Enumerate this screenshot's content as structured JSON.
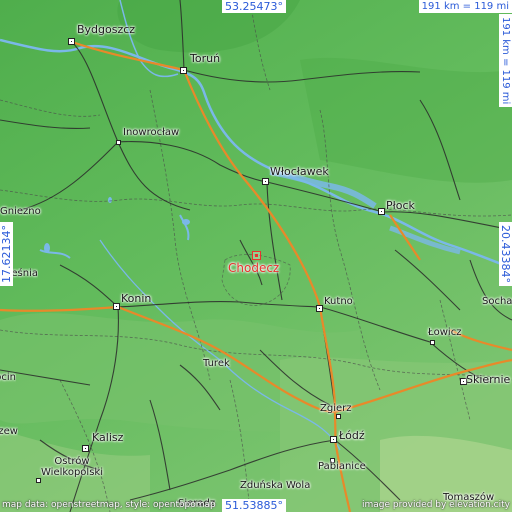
{
  "map": {
    "target": "Chodecz",
    "coords": {
      "top": "53.25473°",
      "bottom": "51.53885°",
      "left": "17.62134°",
      "right": "20.43384°"
    },
    "scale": "191 km = 119 mi",
    "credit_left": "map data: openstreetmap, style: opentopomap",
    "credit_right": "image provided by elevation.city",
    "colors": {
      "land": "#5fb85a",
      "water": "#7ab8e8",
      "road_major": "#e8892a",
      "road_minor": "#2a2a2a",
      "target": "#e8322f",
      "coord_text": "#2a5ad8"
    },
    "cities": [
      {
        "name": "Bydgoszcz"
      },
      {
        "name": "Toruń"
      },
      {
        "name": "Inowrocław"
      },
      {
        "name": "Włocławek"
      },
      {
        "name": "Płock"
      },
      {
        "name": "Gniezno"
      },
      {
        "name": "Konin"
      },
      {
        "name": "Kutno"
      },
      {
        "name": "Łowicz"
      },
      {
        "name": "Sochac"
      },
      {
        "name": "Skiernie"
      },
      {
        "name": "Zgierz"
      },
      {
        "name": "Łódź"
      },
      {
        "name": "Pabianice"
      },
      {
        "name": "Turek"
      },
      {
        "name": "Kalisz"
      },
      {
        "name": "Ostrów Wielkopolski"
      },
      {
        "name": "Zduńska Wola"
      },
      {
        "name": "Tomaszów"
      },
      {
        "name": "Września"
      },
      {
        "name": "Jarocin"
      },
      {
        "name": "Pleszew"
      },
      {
        "name": "Sieradz"
      }
    ]
  }
}
